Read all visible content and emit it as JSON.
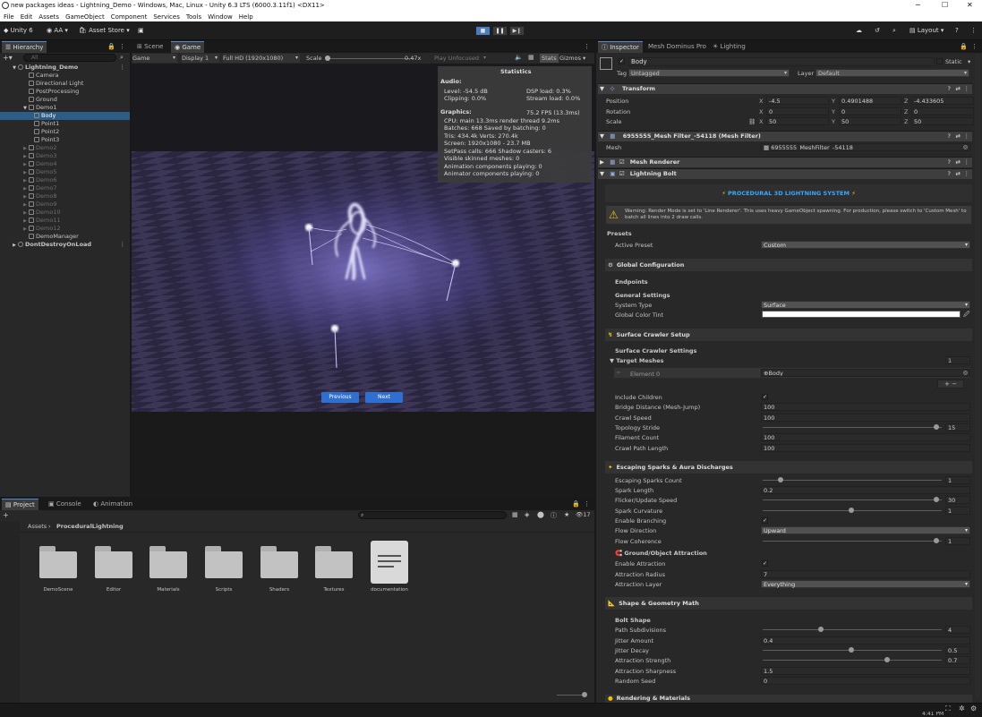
{
  "window": {
    "title": "new packages ideas - Lightning_Demo - Windows, Mac, Linux - Unity 6.3 LTS (6000.3.11f1) <DX11>",
    "minimize": "─",
    "maximize": "☐",
    "close": "✕"
  },
  "menu": [
    "File",
    "Edit",
    "Assets",
    "GameObject",
    "Component",
    "Services",
    "Tools",
    "Window",
    "Help"
  ],
  "toolbar": {
    "unity": "Unity 6",
    "account": "AA",
    "asset_store": "Asset Store",
    "layout": "Layout"
  },
  "hierarchy": {
    "tab": "Hierarchy",
    "search_placeholder": "All",
    "items": [
      {
        "label": "Lightning_Demo",
        "indent": 0,
        "arrow": "▼",
        "scene": true,
        "sel": false,
        "dim": false
      },
      {
        "label": "Camera",
        "indent": 2,
        "arrow": "",
        "scene": false,
        "sel": false,
        "dim": false
      },
      {
        "label": "Directional Light",
        "indent": 2,
        "arrow": "",
        "scene": false,
        "sel": false,
        "dim": false
      },
      {
        "label": "PostProcessing",
        "indent": 2,
        "arrow": "",
        "scene": false,
        "sel": false,
        "dim": false
      },
      {
        "label": "Ground",
        "indent": 2,
        "arrow": "",
        "scene": false,
        "sel": false,
        "dim": false
      },
      {
        "label": "Demo1",
        "indent": 2,
        "arrow": "▼",
        "scene": false,
        "sel": false,
        "dim": false
      },
      {
        "label": "Body",
        "indent": 3,
        "arrow": "",
        "scene": false,
        "sel": true,
        "dim": false
      },
      {
        "label": "Point1",
        "indent": 3,
        "arrow": "",
        "scene": false,
        "sel": false,
        "dim": false
      },
      {
        "label": "Point2",
        "indent": 3,
        "arrow": "",
        "scene": false,
        "sel": false,
        "dim": false
      },
      {
        "label": "Point3",
        "indent": 3,
        "arrow": "",
        "scene": false,
        "sel": false,
        "dim": false
      },
      {
        "label": "Demo2",
        "indent": 2,
        "arrow": "▶",
        "scene": false,
        "sel": false,
        "dim": true
      },
      {
        "label": "Demo3",
        "indent": 2,
        "arrow": "▶",
        "scene": false,
        "sel": false,
        "dim": true
      },
      {
        "label": "Demo4",
        "indent": 2,
        "arrow": "▶",
        "scene": false,
        "sel": false,
        "dim": true
      },
      {
        "label": "Demo5",
        "indent": 2,
        "arrow": "▶",
        "scene": false,
        "sel": false,
        "dim": true
      },
      {
        "label": "Demo6",
        "indent": 2,
        "arrow": "▶",
        "scene": false,
        "sel": false,
        "dim": true
      },
      {
        "label": "Demo7",
        "indent": 2,
        "arrow": "▶",
        "scene": false,
        "sel": false,
        "dim": true
      },
      {
        "label": "Demo8",
        "indent": 2,
        "arrow": "▶",
        "scene": false,
        "sel": false,
        "dim": true
      },
      {
        "label": "Demo9",
        "indent": 2,
        "arrow": "▶",
        "scene": false,
        "sel": false,
        "dim": true
      },
      {
        "label": "Demo10",
        "indent": 2,
        "arrow": "▶",
        "scene": false,
        "sel": false,
        "dim": true
      },
      {
        "label": "Demo11",
        "indent": 2,
        "arrow": "▶",
        "scene": false,
        "sel": false,
        "dim": true
      },
      {
        "label": "Demo12",
        "indent": 2,
        "arrow": "▶",
        "scene": false,
        "sel": false,
        "dim": true
      },
      {
        "label": "DemoManager",
        "indent": 2,
        "arrow": "",
        "scene": false,
        "sel": false,
        "dim": false
      },
      {
        "label": "DontDestroyOnLoad",
        "indent": 0,
        "arrow": "▶",
        "scene": true,
        "sel": false,
        "dim": false
      }
    ]
  },
  "game": {
    "tabs": [
      "Scene",
      "Game"
    ],
    "mode": "Game",
    "display": "Display 1",
    "resolution": "Full HD (1920x1080)",
    "scale_label": "Scale",
    "scale_value": "0.47x",
    "play_focus": "Play Unfocused",
    "stats_btn": "Stats",
    "gizmos": "Gizmos",
    "prev_button": "Previous",
    "next_button": "Next"
  },
  "statistics": {
    "title": "Statistics",
    "audio_hdr": "Audio:",
    "level": "Level: -54.5 dB",
    "clipping": "Clipping: 0.0%",
    "dsp": "DSP load: 0.3%",
    "stream": "Stream load: 0.0%",
    "graphics_hdr": "Graphics:",
    "fps": "75.2 FPS (13.3ms)",
    "cpu": "CPU: main 13.3ms  render thread 9.2ms",
    "batches": "Batches: 668    Saved by batching: 0",
    "tris": "Tris: 434.4k       Verts: 270.4k",
    "screen": "Screen: 1920x1080 - 23.7 MB",
    "setpass": "SetPass calls: 666      Shadow casters: 6",
    "skinned": "Visible skinned meshes: 0",
    "animation": "Animation components playing: 0",
    "animator": "Animator components playing: 0"
  },
  "project": {
    "tabs": [
      "Project",
      "Console",
      "Animation"
    ],
    "breadcrumb": [
      "Assets",
      "ProceduralLightning"
    ],
    "count": "17",
    "folders": [
      "DemoScene",
      "Editor",
      "Materials",
      "Scripts",
      "Shaders",
      "Textures"
    ],
    "file": "documentation"
  },
  "inspector": {
    "tabs": [
      "Inspector",
      "Mesh Dominus Pro",
      "Lighting"
    ],
    "object_name": "Body",
    "static": "Static",
    "tag_label": "Tag",
    "tag": "Untagged",
    "layer_label": "Layer",
    "layer": "Default",
    "transform": {
      "title": "Transform",
      "position_label": "Position",
      "rotation_label": "Rotation",
      "scale_label": "Scale",
      "axes": [
        "X",
        "Y",
        "Z"
      ],
      "position": [
        "-4.5",
        "0.4901488",
        "-4.433605"
      ],
      "rotation": [
        "0",
        "0",
        "0"
      ],
      "scale": [
        "50",
        "50",
        "50"
      ]
    },
    "mesh_filter": {
      "title": "6955555_Mesh Filter_-54118 (Mesh Filter)",
      "mesh_label": "Mesh",
      "mesh": "6955555_MeshFilter_-54118"
    },
    "mesh_renderer": "Mesh Renderer",
    "lightning_bolt": "Lightning Bolt",
    "banner": "PROCEDURAL 3D LIGHTNING SYSTEM",
    "warning": "Warning: Render Mode is set to 'Line Renderer'. This uses heavy GameObject spawning. For production, please switch to 'Custom Mesh' to batch all lines into 2 draw calls.",
    "presets_hdr": "Presets",
    "active_preset_label": "Active Preset",
    "active_preset": "Custom",
    "global_config": "Global Configuration",
    "endpoints": "Endpoints",
    "general_settings": "General Settings",
    "system_type_label": "System Type",
    "system_type": "Surface",
    "global_color_label": "Global Color Tint",
    "surface_crawler": "Surface Crawler Setup",
    "surface_crawler_settings": "Surface Crawler Settings",
    "target_meshes_label": "Target Meshes",
    "target_meshes_count": "1",
    "element0_label": "Element 0",
    "element0": "Body",
    "include_children_label": "Include Children",
    "bridge_label": "Bridge Distance (Mesh-Jump)",
    "bridge": "100",
    "crawl_speed_label": "Crawl Speed",
    "crawl_speed": "100",
    "topology_label": "Topology Stride",
    "topology": "15",
    "filament_label": "Filament Count",
    "filament": "100",
    "crawl_path_label": "Crawl Path Length",
    "crawl_path": "100",
    "sparks_hdr": "Escaping Sparks & Aura Discharges",
    "esc_sparks_label": "Escaping Sparks Count",
    "esc_sparks": "1",
    "spark_length_label": "Spark Length",
    "spark_length": "0.2",
    "flicker_label": "Flicker/Update Speed",
    "flicker": "30",
    "spark_curv_label": "Spark Curvature",
    "spark_curv": "1",
    "enable_branching_label": "Enable Branching",
    "flow_dir_label": "Flow Direction",
    "flow_dir": "Upward",
    "flow_coh_label": "Flow Coherence",
    "flow_coh": "1",
    "ground_attr": "Ground/Object Attraction",
    "enable_attr_label": "Enable Attraction",
    "attr_radius_label": "Attraction Radius",
    "attr_radius": "7",
    "attr_layer_label": "Attraction Layer",
    "attr_layer": "Everything",
    "shape_hdr": "Shape & Geometry Math",
    "bolt_shape": "Bolt Shape",
    "path_sub_label": "Path Subdivisions",
    "path_sub": "4",
    "jitter_amt_label": "Jitter Amount",
    "jitter_amt": "0.4",
    "jitter_decay_label": "Jitter Decay",
    "jitter_decay": "0.5",
    "attr_strength_label": "Attraction Strength",
    "attr_strength": "0.7",
    "attr_sharp_label": "Attraction Sharpness",
    "attr_sharp": "1.5",
    "random_seed_label": "Random Seed",
    "random_seed": "0",
    "rendering_hdr": "Rendering & Materials",
    "sliders": {
      "topology": 0.98,
      "esc_sparks": 0.1,
      "flicker": 0.98,
      "spark_curv": 0.5,
      "flow_coh": 0.98,
      "path_sub": 0.33,
      "jitter_decay": 0.5,
      "attr_strength": 0.7
    }
  },
  "status": {
    "time": "4:41 PM"
  },
  "colors": {
    "accent": "#2c5d87",
    "button_blue": "#2f6fd0",
    "banner_yellow": "#f2c300"
  }
}
